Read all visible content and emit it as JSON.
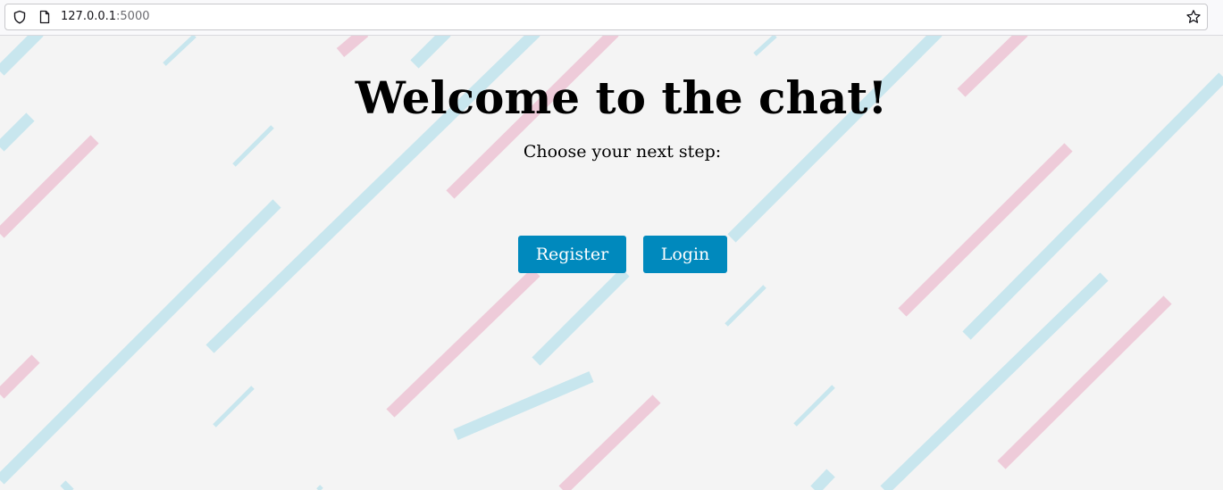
{
  "browser": {
    "url_host": "127.0.0.1",
    "url_port": ":5000",
    "icons": [
      "shield-icon",
      "page-icon",
      "star-icon"
    ]
  },
  "main": {
    "title": "Welcome to the chat!",
    "subtitle": "Choose your next step:",
    "register_label": "Register",
    "login_label": "Login"
  },
  "colors": {
    "page_background": "#f4f4f4",
    "button": "#0089bd",
    "button_text": "#ffffff",
    "stripe_blue": "#c8e6ee",
    "stripe_pink": "#eecbd9"
  }
}
